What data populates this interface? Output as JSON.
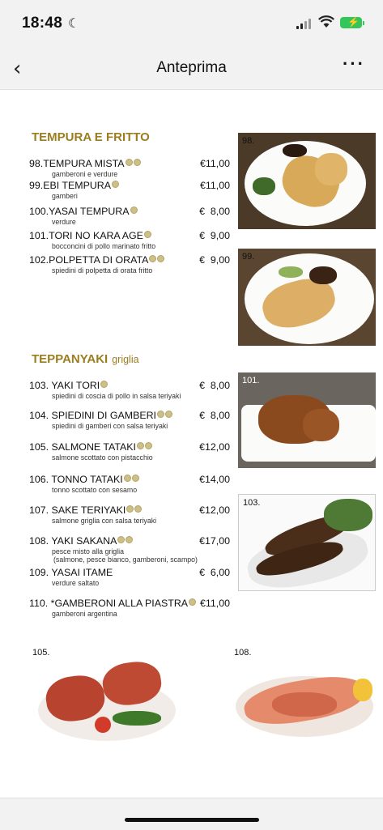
{
  "status": {
    "time": "18:48",
    "moon_icon": "moon-icon",
    "signal_icon": "cellular-signal-icon",
    "wifi_icon": "wifi-icon",
    "battery_icon": "battery-charging-icon"
  },
  "nav": {
    "back_icon": "chevron-left-icon",
    "title": "Anteprima",
    "more_icon": "more-horizontal-icon"
  },
  "sections": {
    "tempura": {
      "title": "TEMPURA E FRITTO"
    },
    "teppanyaki": {
      "title": "TEPPANYAKI",
      "subtitle": "griglia"
    }
  },
  "items": [
    {
      "name": "98.TEMPURA MISTA",
      "desc": "gamberoni e verdure",
      "price": "€11,00",
      "dots": 2
    },
    {
      "name": "99.EBI TEMPURA",
      "desc": "gamberi",
      "price": "€11,00",
      "dots": 1
    },
    {
      "name": "100.YASAI TEMPURA",
      "desc": "verdure",
      "price": "€  8,00",
      "dots": 1
    },
    {
      "name": "101.TORI NO KARA AGE",
      "desc": "bocconcini di pollo marinato fritto",
      "price": "€  9,00",
      "dots": 1
    },
    {
      "name": "102.POLPETTA DI ORATA",
      "desc": "spiedini di polpetta di orata fritto",
      "price": "€  9,00",
      "dots": 2
    },
    {
      "name": "103. YAKI TORI",
      "desc": "spiedini di coscia di pollo in salsa teriyaki",
      "price": "€  8,00",
      "dots": 1
    },
    {
      "name": "104. SPIEDINI DI GAMBERI",
      "desc": "spiedini di gamberi con salsa teriyaki",
      "price": "€  8,00",
      "dots": 2
    },
    {
      "name": "105. SALMONE TATAKI",
      "desc": "salmone scottato con pistacchio",
      "price": "€12,00",
      "dots": 2
    },
    {
      "name": "106. TONNO TATAKI",
      "desc": "tonno scottato con sesamo",
      "price": "€14,00",
      "dots": 2
    },
    {
      "name": "107. SAKE TERIYAKI",
      "desc": "salmone griglia con salsa teriyaki",
      "price": "€12,00",
      "dots": 2
    },
    {
      "name": "108. YAKI SAKANA",
      "desc": "pesce misto alla griglia",
      "desc2": "(salmone, pesce bianco, gamberoni, scampo)",
      "price": "€17,00",
      "dots": 2
    },
    {
      "name": "109. YASAI ITAME",
      "desc": "verdure saltato",
      "price": "€  6,00",
      "dots": 0
    },
    {
      "name": "110. *GAMBERONI ALLA PIASTRA",
      "desc": "gamberoni argentina",
      "price": "€11,00",
      "dots": 1
    }
  ],
  "photos": [
    {
      "label": "98."
    },
    {
      "label": "99."
    },
    {
      "label": "101."
    },
    {
      "label": "103."
    },
    {
      "label": "105."
    },
    {
      "label": "108."
    }
  ]
}
